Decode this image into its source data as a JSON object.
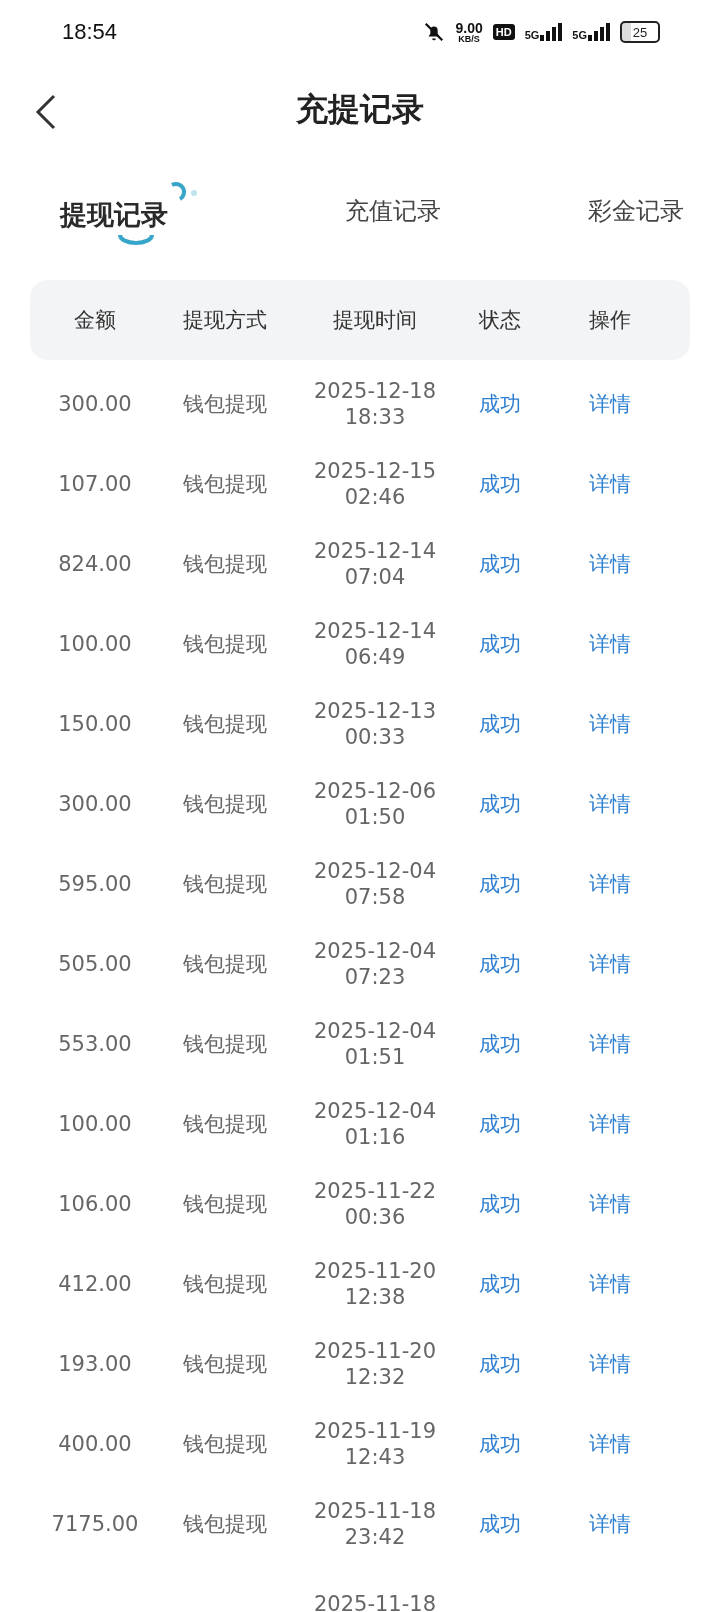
{
  "status_bar": {
    "time": "18:54",
    "speed": "9.00",
    "speed_unit": "KB/S",
    "hd": "HD",
    "network_1": "5G",
    "network_2": "5G",
    "battery": "25"
  },
  "header": {
    "title": "充提记录"
  },
  "tabs": [
    {
      "label": "提现记录",
      "selected": true
    },
    {
      "label": "充值记录",
      "selected": false
    },
    {
      "label": "彩金记录",
      "selected": false
    }
  ],
  "table": {
    "columns": [
      "金额",
      "提现方式",
      "提现时间",
      "状态",
      "操作"
    ],
    "rows": [
      {
        "amount": "300.00",
        "method": "钱包提现",
        "date": "2025-12-18",
        "time": "18:33",
        "status": "成功",
        "action": "详情"
      },
      {
        "amount": "107.00",
        "method": "钱包提现",
        "date": "2025-12-15",
        "time": "02:46",
        "status": "成功",
        "action": "详情"
      },
      {
        "amount": "824.00",
        "method": "钱包提现",
        "date": "2025-12-14",
        "time": "07:04",
        "status": "成功",
        "action": "详情"
      },
      {
        "amount": "100.00",
        "method": "钱包提现",
        "date": "2025-12-14",
        "time": "06:49",
        "status": "成功",
        "action": "详情"
      },
      {
        "amount": "150.00",
        "method": "钱包提现",
        "date": "2025-12-13",
        "time": "00:33",
        "status": "成功",
        "action": "详情"
      },
      {
        "amount": "300.00",
        "method": "钱包提现",
        "date": "2025-12-06",
        "time": "01:50",
        "status": "成功",
        "action": "详情"
      },
      {
        "amount": "595.00",
        "method": "钱包提现",
        "date": "2025-12-04",
        "time": "07:58",
        "status": "成功",
        "action": "详情"
      },
      {
        "amount": "505.00",
        "method": "钱包提现",
        "date": "2025-12-04",
        "time": "07:23",
        "status": "成功",
        "action": "详情"
      },
      {
        "amount": "553.00",
        "method": "钱包提现",
        "date": "2025-12-04",
        "time": "01:51",
        "status": "成功",
        "action": "详情"
      },
      {
        "amount": "100.00",
        "method": "钱包提现",
        "date": "2025-12-04",
        "time": "01:16",
        "status": "成功",
        "action": "详情"
      },
      {
        "amount": "106.00",
        "method": "钱包提现",
        "date": "2025-11-22",
        "time": "00:36",
        "status": "成功",
        "action": "详情"
      },
      {
        "amount": "412.00",
        "method": "钱包提现",
        "date": "2025-11-20",
        "time": "12:38",
        "status": "成功",
        "action": "详情"
      },
      {
        "amount": "193.00",
        "method": "钱包提现",
        "date": "2025-11-20",
        "time": "12:32",
        "status": "成功",
        "action": "详情"
      },
      {
        "amount": "400.00",
        "method": "钱包提现",
        "date": "2025-11-19",
        "time": "12:43",
        "status": "成功",
        "action": "详情"
      },
      {
        "amount": "7175.00",
        "method": "钱包提现",
        "date": "2025-11-18",
        "time": "23:42",
        "status": "成功",
        "action": "详情"
      },
      {
        "date": "2025-11-18"
      }
    ]
  }
}
